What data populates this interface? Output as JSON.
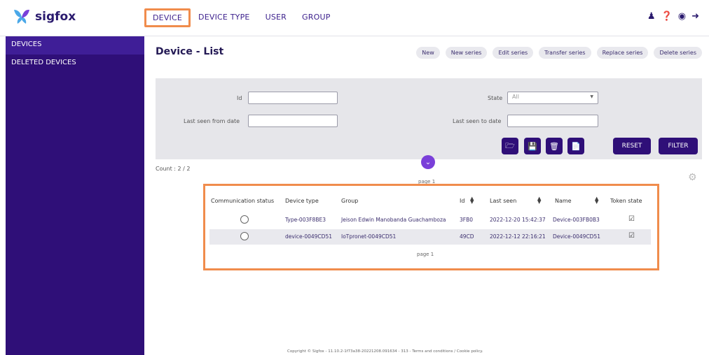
{
  "brand": {
    "name": "sigfox"
  },
  "nav": {
    "items": [
      "DEVICE",
      "DEVICE TYPE",
      "USER",
      "GROUP"
    ]
  },
  "top_icons": [
    "user-icon",
    "help-icon",
    "eye-icon",
    "logout-icon"
  ],
  "sidebar": {
    "items": [
      "DEVICES",
      "DELETED DEVICES"
    ]
  },
  "page": {
    "title": "Device - List"
  },
  "actions": [
    "New",
    "New series",
    "Edit series",
    "Transfer series",
    "Replace series",
    "Delete series"
  ],
  "filters": {
    "id_label": "Id",
    "last_seen_from_label": "Last seen from date",
    "state_label": "State",
    "state_value": "All",
    "last_seen_to_label": "Last seen to date",
    "reset_label": "RESET",
    "filter_label": "FILTER"
  },
  "count_text": "Count : 2 / 2",
  "pagination": {
    "top": "page 1",
    "bottom": "page 1"
  },
  "table": {
    "headers": [
      "Communication status",
      "Device type",
      "Group",
      "Id",
      "Last seen",
      "Name",
      "Token state"
    ],
    "rows": [
      {
        "device_type": "Type-003F8BE3",
        "group": "Jeison Edwin Manobanda Guachamboza",
        "id": "3FB0",
        "last_seen": "2022-12-20 15:42:37",
        "name": "Device-003FB0B3"
      },
      {
        "device_type": "device-0049CD51",
        "group": "IoTpronet-0049CD51",
        "id": "49CD",
        "last_seen": "2022-12-12 22:16:21",
        "name": "Device-0049CD51"
      }
    ]
  },
  "footer": {
    "text": "Copyright © Sigfox - 11.10.2-1f73a38-20221208.091634 - 313 - Terms and conditions / Cookie policy."
  },
  "colors": {
    "primary": "#2f0f78",
    "accent": "#f08c4c",
    "toggle": "#7a3fd9"
  }
}
